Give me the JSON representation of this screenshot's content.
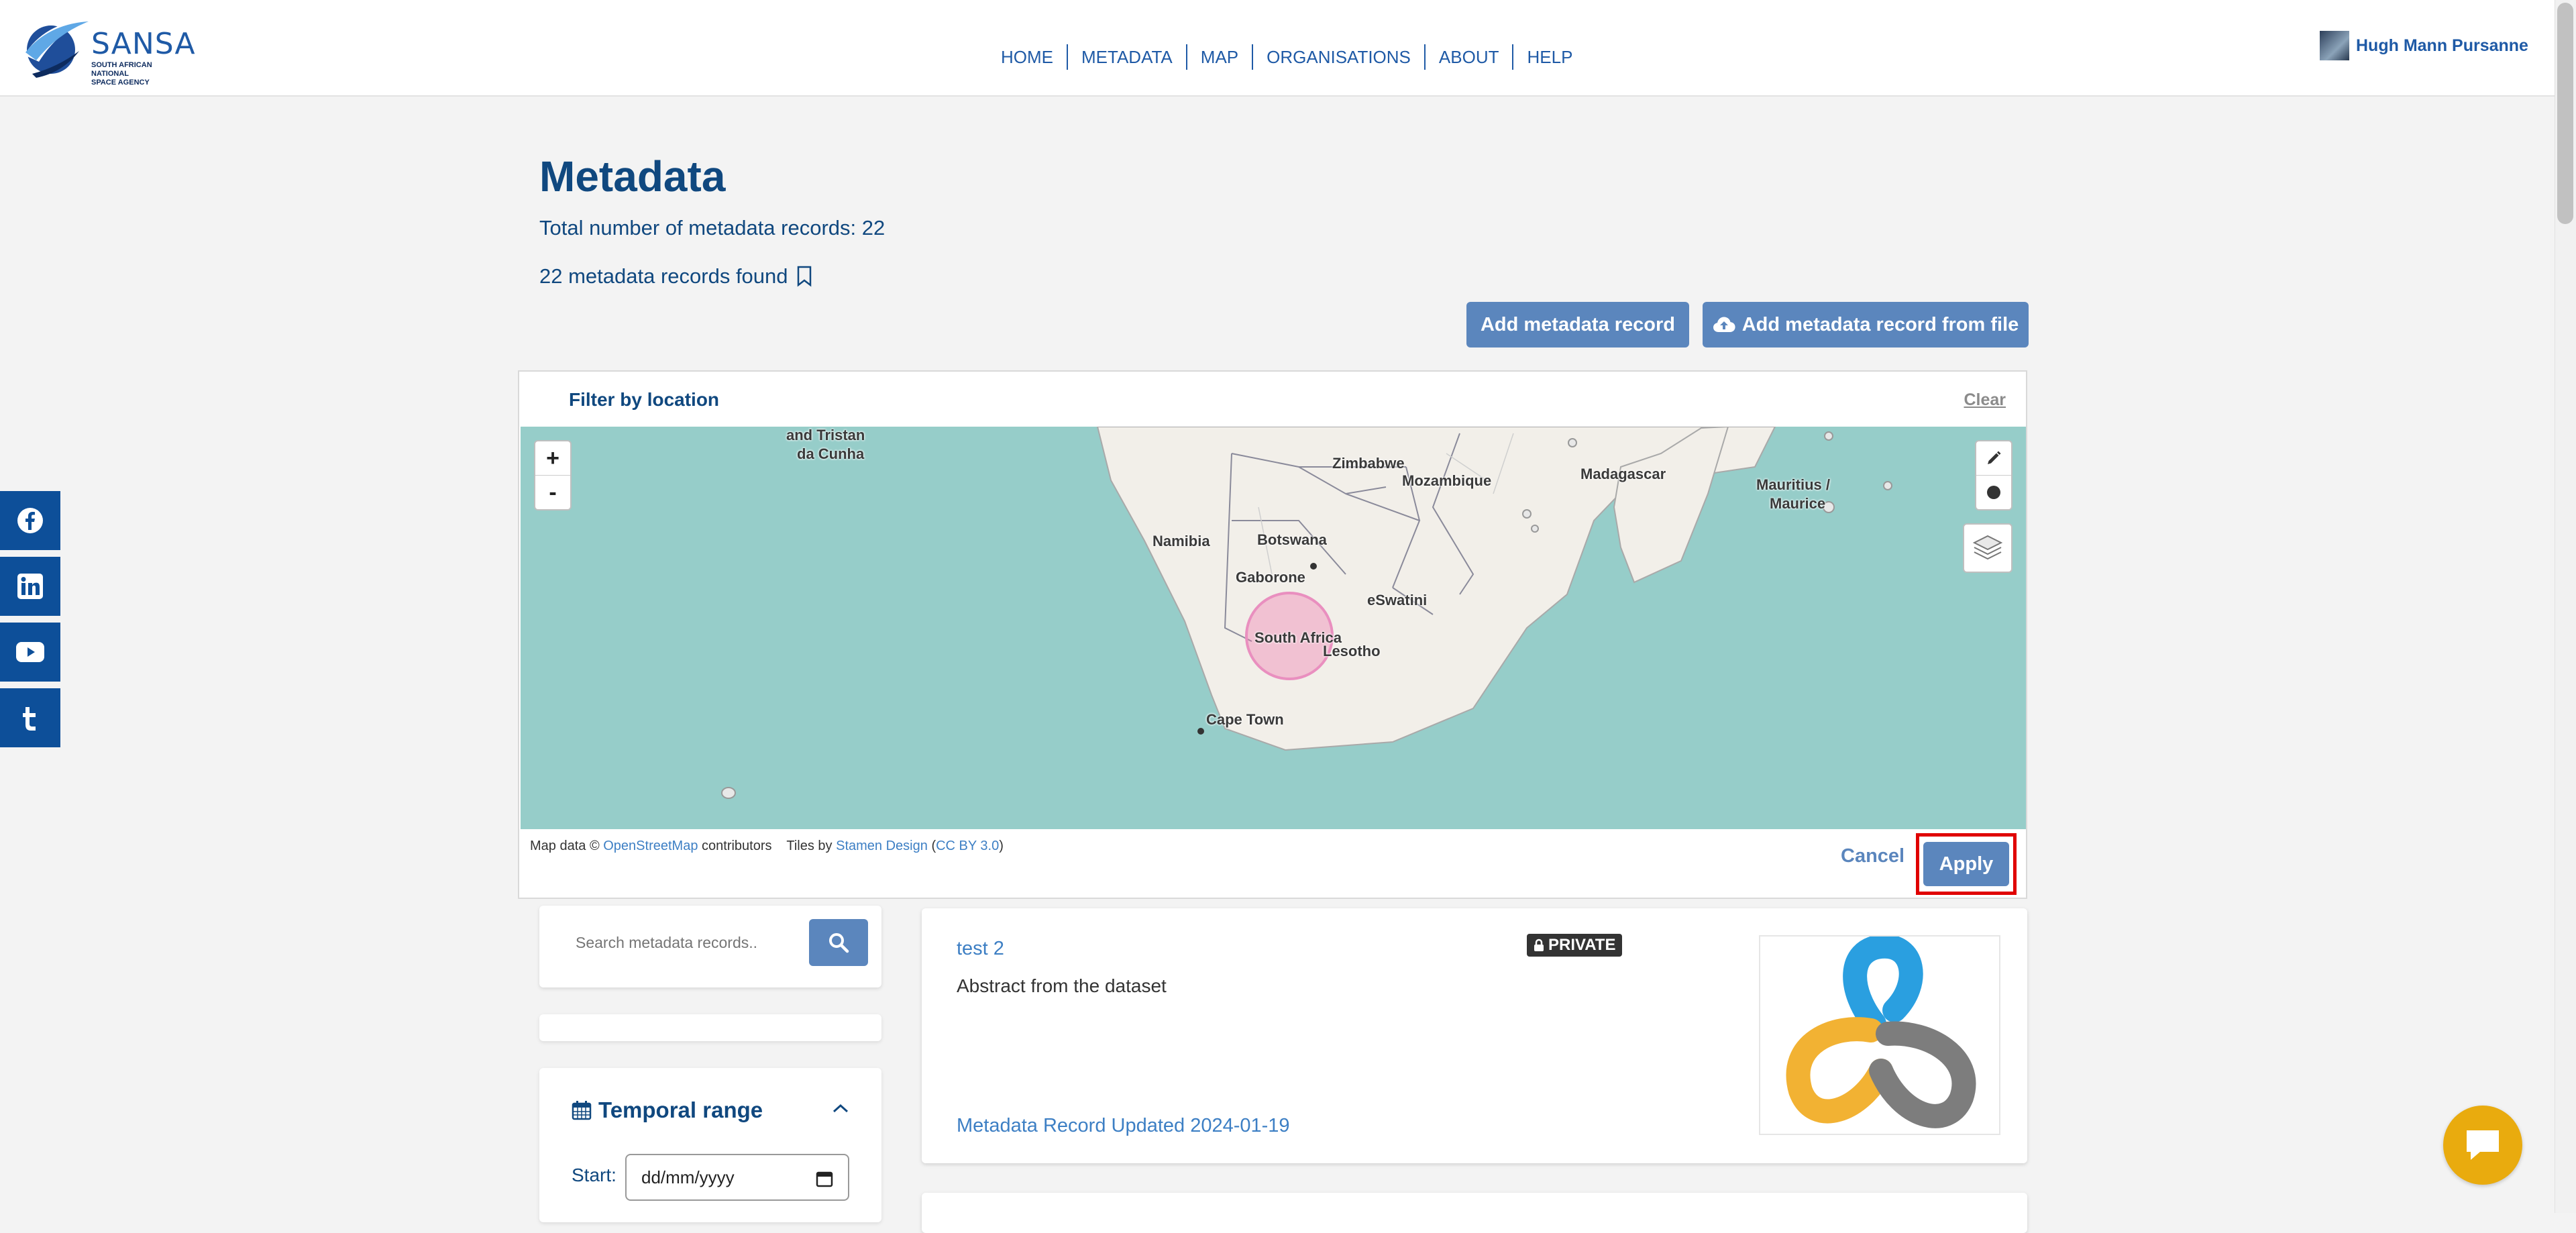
{
  "brand": {
    "name": "SANSA",
    "subtitle_line1": "SOUTH AFRICAN NATIONAL",
    "subtitle_line2": "SPACE AGENCY",
    "colors": {
      "primary": "#1f5aa6",
      "dark": "#10487f",
      "button": "#5b86bd",
      "social": "#0d4f99",
      "chat": "#e9ab0e"
    }
  },
  "nav": {
    "items": [
      {
        "label": "HOME"
      },
      {
        "label": "METADATA"
      },
      {
        "label": "MAP"
      },
      {
        "label": "ORGANISATIONS"
      },
      {
        "label": "ABOUT"
      },
      {
        "label": "HELP"
      }
    ]
  },
  "user": {
    "name": "Hugh Mann Pursanne"
  },
  "social": [
    "facebook-icon",
    "linkedin-icon",
    "youtube-icon",
    "tumblr-icon"
  ],
  "page": {
    "title": "Metadata",
    "total": "Total number of metadata records: 22",
    "found": "22 metadata records found",
    "add_record": "Add metadata record",
    "add_from_file": "Add metadata record from file"
  },
  "filter": {
    "title": "Filter by location",
    "clear": "Clear",
    "cancel": "Cancel",
    "apply": "Apply",
    "zoom_in": "+",
    "zoom_out": "-",
    "map_labels": {
      "tristan": "and Tristan",
      "tristan2": "da Cunha",
      "zimbabwe": "Zimbabwe",
      "mozambique": "Mozambique",
      "madagascar": "Madagascar",
      "mauritius": "Mauritius /",
      "mauritius2": "Maurice",
      "namibia": "Namibia",
      "botswana": "Botswana",
      "gaborone": "Gaborone",
      "eswatini": "eSwatini",
      "south_africa": "South Africa",
      "lesotho": "Lesotho",
      "cape_town": "Cape Town"
    },
    "attribution": {
      "prefix": "Map data ©",
      "osm": "OpenStreetMap",
      "contributors": "contributors",
      "tiles": "Tiles by",
      "stamen": "Stamen Design",
      "open_paren": "(",
      "license": "CC BY 3.0",
      "close_paren": ")"
    }
  },
  "sidebar": {
    "search_placeholder": "Search metadata records..",
    "temporal": {
      "title": "Temporal range",
      "start_label": "Start:",
      "start_value": "dd/mm/yyyy"
    }
  },
  "records": [
    {
      "title": "test 2",
      "badge": "PRIVATE",
      "abstract": "Abstract from the dataset",
      "updated": "Metadata Record Updated 2024-01-19"
    }
  ]
}
